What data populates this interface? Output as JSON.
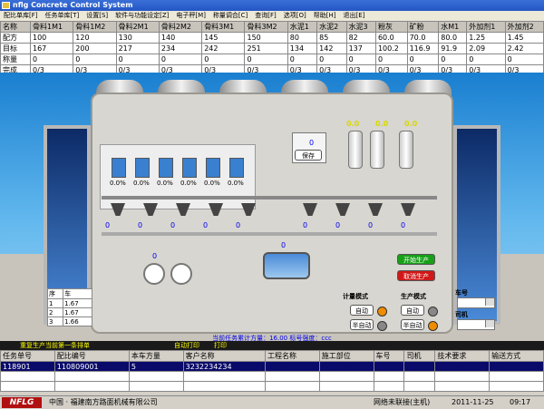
{
  "window": {
    "title": "nflg Concrete Control System"
  },
  "menu": [
    "配比单库[F]",
    "任务单库[T]",
    "设置[S]",
    "软件与功能设定[Z]",
    "电子秤[M]",
    "称量调合[C]",
    "查询[F]",
    "选项[O]",
    "帮助[H]",
    "退出[E]"
  ],
  "recipe_table": {
    "headers": [
      "名称",
      "骨料1M1",
      "骨料1M2",
      "骨料2M1",
      "骨料2M2",
      "骨料3M1",
      "骨料3M2",
      "水泥1",
      "水泥2",
      "水泥3",
      "粉灰",
      "矿粉",
      "水M1",
      "外加剂1",
      "外加剂2"
    ],
    "rows": [
      {
        "label": "配方",
        "values": [
          "100",
          "120",
          "130",
          "140",
          "145",
          "150",
          "80",
          "85",
          "82",
          "60.0",
          "70.0",
          "80.0",
          "1.25",
          "1.45"
        ]
      },
      {
        "label": "目标",
        "values": [
          "167",
          "200",
          "217",
          "234",
          "242",
          "251",
          "134",
          "142",
          "137",
          "100.2",
          "116.9",
          "91.9",
          "2.09",
          "2.42"
        ]
      },
      {
        "label": "称量",
        "values": [
          "0",
          "0",
          "0",
          "0",
          "0",
          "0",
          "0",
          "0",
          "0",
          "0",
          "0",
          "0",
          "0",
          "0"
        ]
      },
      {
        "label": "完成",
        "values": [
          "0/3",
          "0/3",
          "0/3",
          "0/3",
          "0/3",
          "0/3",
          "0/3",
          "0/3",
          "0/3",
          "0/3",
          "0/3",
          "0/3",
          "0/3",
          "0/3"
        ]
      }
    ]
  },
  "plant": {
    "hopper_values": [
      "0.0%",
      "0.0%",
      "0.0%",
      "0.0%",
      "0.0%",
      "0.0%"
    ],
    "water_value": "0",
    "save_label": "保存",
    "tank_values": [
      "0.0",
      "0.0",
      "0.0"
    ],
    "scale_values": [
      "0",
      "0",
      "0",
      "0",
      "0",
      "0",
      "0",
      "0",
      "0"
    ],
    "start_label": "开始生产",
    "cancel_label": "取消生产",
    "mixer_values": [
      "0",
      "0"
    ]
  },
  "mini_table": {
    "header": [
      "序",
      "车"
    ],
    "rows": [
      [
        "1",
        "1.67"
      ],
      [
        "2",
        "1.67"
      ],
      [
        "3",
        "1.66"
      ]
    ]
  },
  "controls": {
    "metering_mode_label": "计量模式",
    "production_mode_label": "生产模式",
    "auto_label": "自动",
    "semi_auto_label": "半自动",
    "truck_label": "车号",
    "driver_label": "司机",
    "status_line": "当前任务累计方量：16.00 标号强度：ccc"
  },
  "bottom_bar": {
    "text": "重复生产当前第一条排单",
    "auto_print": "自动打印",
    "print": "打印"
  },
  "task_table": {
    "headers": [
      "任务单号",
      "配比编号",
      "本车方量",
      "客户名称",
      "工程名称",
      "施工部位",
      "车号",
      "司机",
      "技术要求",
      "输送方式"
    ],
    "rows": [
      [
        "118901",
        "110809001",
        "5",
        "3232234234",
        "",
        "",
        "",
        "",
        "",
        ""
      ]
    ]
  },
  "status_bar": {
    "logo": "NFLG",
    "company": "中国 · 福建南方路面机械有限公司",
    "network": "网络未联接(主机)",
    "date": "2011-11-25",
    "time": "09:17"
  },
  "colors": {
    "title_bar": "#2456c4",
    "green_button": "#18a018",
    "red_button": "#d01818",
    "value_blue": "#0000ee"
  }
}
